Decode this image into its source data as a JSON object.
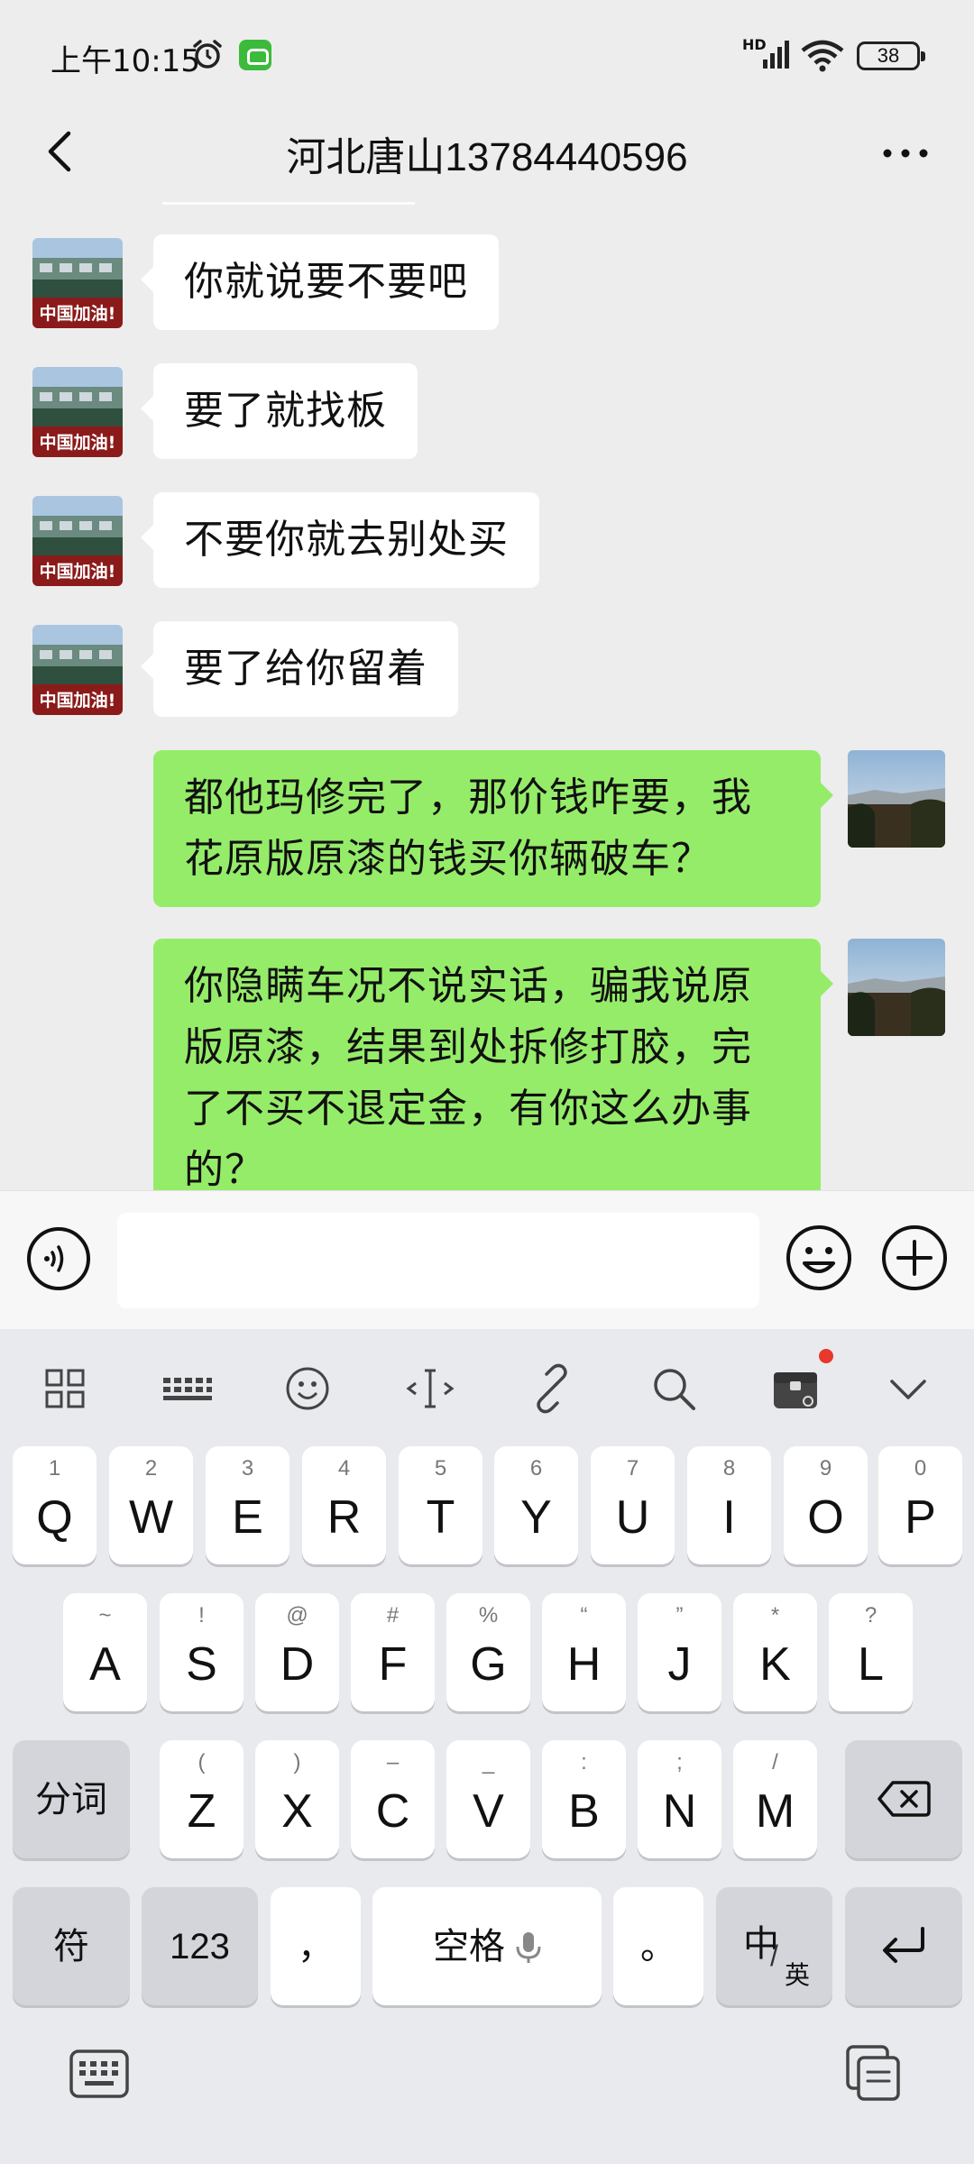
{
  "status": {
    "time": "上午10:15",
    "network": "HD",
    "battery": "38"
  },
  "header": {
    "title": "河北唐山13784440596"
  },
  "messages": [
    {
      "side": "in",
      "text": "你就说要不要吧"
    },
    {
      "side": "in",
      "text": "要了就找板"
    },
    {
      "side": "in",
      "text": "不要你就去别处买"
    },
    {
      "side": "in",
      "text": "要了给你留着"
    },
    {
      "side": "out",
      "text": "都他玛修完了，那价钱咋要，我花原版原漆的钱买你辆破车？"
    },
    {
      "side": "out",
      "text": "你隐瞒车况不说实话，骗我说原版原漆，结果到处拆修打胶，完了不买不退定金，有你这么办事的？"
    }
  ],
  "contact_avatar": {
    "banner_text": "中国加油！"
  },
  "input": {
    "value": ""
  },
  "keyboard": {
    "toolbar": [
      "grid-icon",
      "keyboard-layout-icon",
      "emoji-icon",
      "cursor-icon",
      "link-icon",
      "search-icon",
      "clipboard-box-icon",
      "collapse-icon"
    ],
    "row1": [
      {
        "main": "Q",
        "sub": "1"
      },
      {
        "main": "W",
        "sub": "2"
      },
      {
        "main": "E",
        "sub": "3"
      },
      {
        "main": "R",
        "sub": "4"
      },
      {
        "main": "T",
        "sub": "5"
      },
      {
        "main": "Y",
        "sub": "6"
      },
      {
        "main": "U",
        "sub": "7"
      },
      {
        "main": "I",
        "sub": "8"
      },
      {
        "main": "O",
        "sub": "9"
      },
      {
        "main": "P",
        "sub": "0"
      }
    ],
    "row2": [
      {
        "main": "A",
        "sub": "~"
      },
      {
        "main": "S",
        "sub": "!"
      },
      {
        "main": "D",
        "sub": "@"
      },
      {
        "main": "F",
        "sub": "#"
      },
      {
        "main": "G",
        "sub": "%"
      },
      {
        "main": "H",
        "sub": "“"
      },
      {
        "main": "J",
        "sub": "”"
      },
      {
        "main": "K",
        "sub": "*"
      },
      {
        "main": "L",
        "sub": "?"
      }
    ],
    "row3": [
      {
        "main": "Z",
        "sub": "("
      },
      {
        "main": "X",
        "sub": ")"
      },
      {
        "main": "C",
        "sub": "–"
      },
      {
        "main": "V",
        "sub": "_"
      },
      {
        "main": "B",
        "sub": ":"
      },
      {
        "main": "N",
        "sub": ";"
      },
      {
        "main": "M",
        "sub": "/"
      }
    ],
    "segment_label": "分词",
    "symbol_label": "符",
    "number_label": "123",
    "comma_label": "，",
    "space_label": "空格",
    "period_label": "。",
    "lang_main": "中",
    "lang_sub": "英"
  },
  "colors": {
    "out_bubble": "#95ec69",
    "in_bubble": "#ffffff",
    "badge": "#e8372b"
  }
}
